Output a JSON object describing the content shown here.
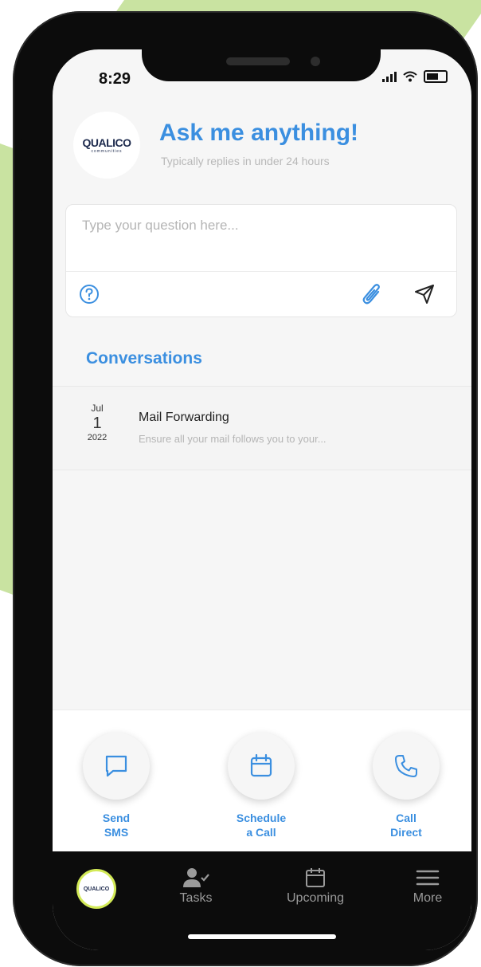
{
  "status_bar": {
    "time": "8:29"
  },
  "header": {
    "logo_name": "QUALICO",
    "logo_sub": "communities",
    "title": "Ask me anything!",
    "subtitle": "Typically replies in under 24 hours"
  },
  "compose": {
    "placeholder": "Type your question here..."
  },
  "conversations": {
    "title": "Conversations",
    "items": [
      {
        "month": "Jul",
        "day": "1",
        "year": "2022",
        "name": "Mail Forwarding",
        "preview": "Ensure all your mail follows you to your..."
      }
    ]
  },
  "actions": [
    {
      "line1": "Send",
      "line2": "SMS",
      "icon": "chat-bubble-icon"
    },
    {
      "line1": "Schedule",
      "line2": "a Call",
      "icon": "calendar-icon"
    },
    {
      "line1": "Call",
      "line2": "Direct",
      "icon": "phone-icon"
    }
  ],
  "tabbar": {
    "home_logo": "QUALICO",
    "tabs": [
      {
        "label": "Tasks",
        "icon": "user-check-icon"
      },
      {
        "label": "Upcoming",
        "icon": "calendar-icon"
      },
      {
        "label": "More",
        "icon": "menu-icon"
      }
    ]
  },
  "colors": {
    "accent": "#3b8fe0",
    "background_green": "#c9e3a1",
    "logo_ring": "#d3ea57"
  }
}
